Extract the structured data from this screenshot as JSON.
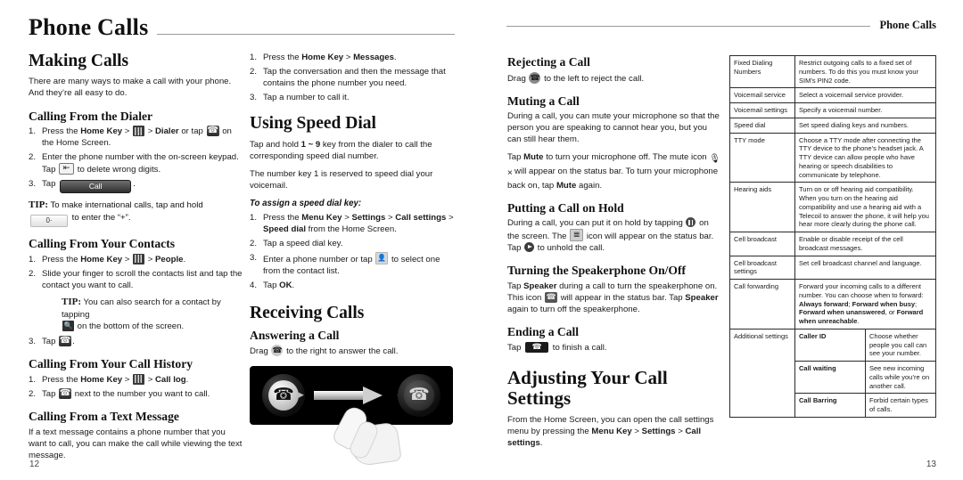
{
  "document": {
    "title": "Phone Calls",
    "left_page_header": "Phone Calls",
    "right_page_header": "Phone Calls",
    "left_folio": "12",
    "right_folio": "13"
  },
  "making_calls": {
    "heading": "Making Calls",
    "intro": "There are many ways to make a call with your phone. And they’re all easy to do.",
    "dialer": {
      "heading": "Calling From the Dialer",
      "step1_a": "Press the ",
      "step1_home": "Home Key",
      "step1_gt1": " > ",
      "step1_gt2": " > ",
      "step1_dialer": "Dialer",
      "step1_or": " or tap ",
      "step1_end": " on the Home Screen.",
      "step2_a": "Enter the phone number with the on-screen keypad. Tap ",
      "step2_b": " to delete wrong digits.",
      "step3_a": "Tap ",
      "step3_btn": "Call",
      "step3_b": ".",
      "tip_label": "TIP:",
      "tip_a": " To make international calls, tap and hold ",
      "tip_key": "0·",
      "tip_b": " to enter the “+”."
    },
    "contacts": {
      "heading": "Calling From Your Contacts",
      "step1_a": "Press the ",
      "step1_home": "Home Key",
      "step1_people": "People",
      "step1_end": ".",
      "step2": "Slide your finger to scroll the contacts list and tap the contact you want to call.",
      "tip_label": "TIP:",
      "tip_a": " You can also search for a contact by tapping ",
      "tip_b": " on the bottom of the screen.",
      "step3_a": "Tap ",
      "step3_b": "."
    },
    "history": {
      "heading": "Calling From Your Call History",
      "step1_a": "Press the ",
      "step1_home": "Home Key",
      "step1_calllog": "Call log",
      "step1_end": ".",
      "step2_a": "Tap ",
      "step2_b": " next to the number you want to call."
    },
    "text_message": {
      "heading": "Calling From a Text Message",
      "body": "If a text message contains a phone number that you want to call, you can make the call while viewing the text message.",
      "step1_a": "Press the ",
      "step1_home": "Home Key",
      "step1_messages": "Messages",
      "step1_end": ".",
      "step2": "Tap the conversation and then the message that contains the phone number you need.",
      "step3": "Tap a number to call it."
    },
    "speed_dial": {
      "heading": "Using Speed Dial",
      "p1_a": "Tap and hold ",
      "p1_keys": "1 ~ 9",
      "p1_b": " key from the dialer to call the corresponding speed dial number.",
      "p2": "The number key 1 is reserved to speed dial your voicemail.",
      "assign_heading": "To assign a speed dial key:",
      "step1_a": "Press the ",
      "step1_menu": "Menu Key",
      "step1_settings": "Settings",
      "step1_callsettings": "Call settings",
      "step1_speeddial": "Speed dial",
      "step1_end": " from the Home Screen.",
      "step2": "Tap a speed dial key.",
      "step3_a": "Enter a phone number or tap ",
      "step3_b": " to select one from the contact list.",
      "step4_a": "Tap ",
      "step4_ok": "OK",
      "step4_b": "."
    }
  },
  "receiving_calls": {
    "heading": "Receiving Calls",
    "answering": {
      "heading": "Answering a Call",
      "body_a": "Drag ",
      "body_b": " to the right to answer the call."
    },
    "illustration": {
      "left_knob_icon": "answer-phone-icon",
      "right_knob_icon": "reject-phone-icon",
      "arrow_icon": "drag-right-arrow",
      "hand_icon": "hand-pointer-icon"
    },
    "rejecting": {
      "heading": "Rejecting a Call",
      "body_a": "Drag ",
      "body_b": " to the left to reject the call."
    },
    "muting": {
      "heading": "Muting a Call",
      "p1": "During a call, you can mute your microphone so that the person you are speaking to cannot hear you, but you can still hear them.",
      "p2_a": "Tap ",
      "p2_mute1": "Mute",
      "p2_b": " to turn your microphone off. The mute icon ",
      "p2_icon": "🎙×",
      "p2_c": " will appear on the status bar. To turn your microphone back on, tap ",
      "p2_mute2": "Mute",
      "p2_d": " again."
    },
    "hold": {
      "heading": "Putting a Call on Hold",
      "p_a": "During a call, you can put it on hold by tapping ",
      "p_b": " on the screen. The ",
      "p_c": " icon will appear on the status bar. Tap ",
      "p_d": " to unhold the call."
    },
    "speakerphone": {
      "heading": "Turning the Speakerphone On/Off",
      "p_a": "Tap ",
      "p_speaker1": "Speaker",
      "p_b": " during a call to turn the speakerphone on. This icon ",
      "p_c": " will appear in the status bar. Tap ",
      "p_speaker2": "Speaker",
      "p_d": " again to turn off the speakerphone."
    },
    "ending": {
      "heading": "Ending a Call",
      "p_a": "Tap ",
      "p_b": " to finish a call."
    }
  },
  "call_settings": {
    "heading": "Adjusting Your Call Settings",
    "intro_a": "From the Home Screen, you can open the call settings menu by pressing the ",
    "intro_menu": "Menu Key",
    "intro_settings": "Settings",
    "intro_callsettings": "Call settings",
    "intro_end": ".",
    "table": [
      {
        "key": "Fixed Dialing Numbers",
        "value": "Restrict outgoing calls to a fixed set of numbers. To do this you must know your SIM’s PIN2 code."
      },
      {
        "key": "Voicemail service",
        "value": "Select a voicemail service provider."
      },
      {
        "key": "Voicemail settings",
        "value": "Specify a voicemail number."
      },
      {
        "key": "Speed dial",
        "value": "Set speed dialing keys and numbers."
      },
      {
        "key": "TTY mode",
        "value": "Choose a TTY mode after connecting the TTY device to the phone’s headset jack. A TTY device can allow people who have hearing or speech disabilities to communicate by telephone."
      },
      {
        "key": "Hearing aids",
        "value": "Turn on or off hearing aid compatibility. When you turn on the hearing aid compatibility and use a hearing aid with a Telecoil to answer the phone, it will help you hear more clearly during the phone call."
      },
      {
        "key": "Cell broadcast",
        "value": "Enable or disable receipt of the cell broadcast messages."
      },
      {
        "key": "Cell broadcast settings",
        "value": "Set cell broadcast channel and language."
      },
      {
        "key": "Call forwarding",
        "value": "Forward your incoming calls to a different number. You can choose when to forward:"
      }
    ],
    "forwarding_options": {
      "o1": "Always forward",
      "sep1": "; ",
      "o2": "Forward when busy",
      "sep2": "; ",
      "o3": "Forward when unanswered",
      "sep3": ", or ",
      "o4": "Forward when unreachable",
      "end": "."
    },
    "additional": {
      "key": "Additional settings",
      "rows": [
        {
          "subkey": "Caller ID",
          "value": "Choose whether people you call can see your number."
        },
        {
          "subkey": "Call waiting",
          "value": "See new incoming calls while you’re on another call."
        },
        {
          "subkey": "Call Barring",
          "value": "Forbid certain types of calls."
        }
      ]
    }
  }
}
